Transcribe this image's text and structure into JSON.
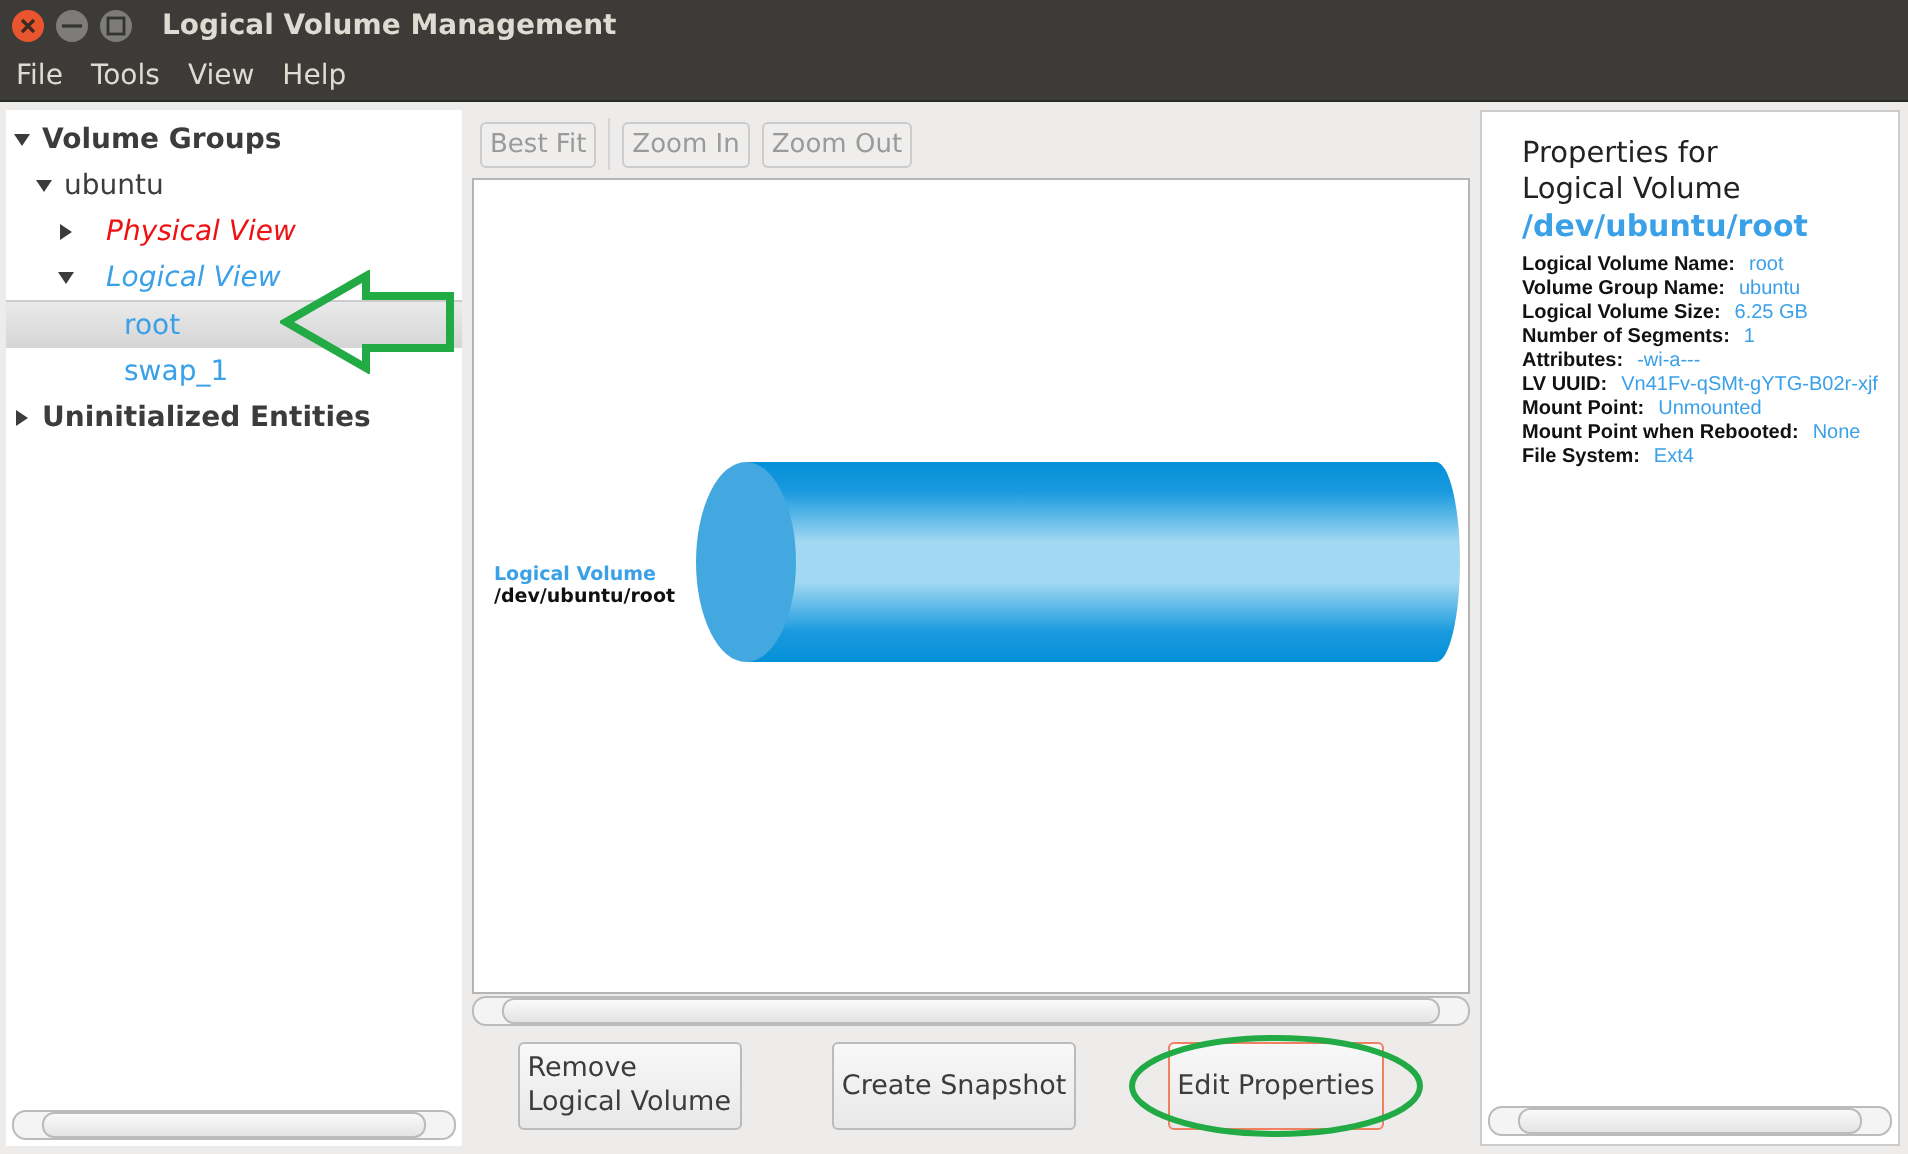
{
  "window": {
    "title": "Logical Volume Management"
  },
  "menu": [
    "File",
    "Tools",
    "View",
    "Help"
  ],
  "tree": [
    {
      "label": "Volume Groups",
      "kind": "heading",
      "expanded": true,
      "selected": false,
      "color": "#3c3c3c",
      "children": [
        {
          "label": "ubuntu",
          "kind": "group",
          "expanded": true,
          "selected": false,
          "color": "#3c3c3c",
          "children": [
            {
              "label": "Physical View",
              "kind": "view",
              "expanded": false,
              "selected": false,
              "color": "#ee1111"
            },
            {
              "label": "Logical View",
              "kind": "view",
              "expanded": true,
              "selected": false,
              "color": "#3aa0e8",
              "children": [
                {
                  "label": "root",
                  "kind": "volume",
                  "selected": true,
                  "color": "#3aa0e8"
                },
                {
                  "label": "swap_1",
                  "kind": "volume",
                  "selected": false,
                  "color": "#3aa0e8"
                }
              ]
            }
          ]
        }
      ]
    },
    {
      "label": "Uninitialized Entities",
      "kind": "heading",
      "expanded": false,
      "selected": false,
      "color": "#3c3c3c"
    }
  ],
  "toolbar": [
    {
      "label": "Best Fit",
      "disabled": true
    },
    {
      "label": "Zoom In",
      "disabled": true
    },
    {
      "label": "Zoom Out",
      "disabled": true
    }
  ],
  "canvas": {
    "kind_label": "Logical Volume",
    "path": "/dev/ubuntu/root"
  },
  "actions": [
    {
      "label": "Remove\nLogical Volume",
      "focused": false
    },
    {
      "label": "Create Snapshot",
      "focused": false
    },
    {
      "label": "Edit Properties",
      "focused": true
    }
  ],
  "properties": {
    "title": "Properties for\nLogical Volume",
    "path": "/dev/ubuntu/root",
    "fields": [
      {
        "label": "Logical Volume Name:",
        "value": "root"
      },
      {
        "label": "Volume Group Name:",
        "value": "ubuntu"
      },
      {
        "label": "Logical Volume Size:",
        "value": "6.25 GB"
      },
      {
        "label": "Number of Segments:",
        "value": "1"
      },
      {
        "label": "Attributes:",
        "value": "-wi-a---"
      },
      {
        "label": "LV UUID:",
        "value": "Vn41Fv-qSMt-gYTG-B02r-xjf"
      },
      {
        "label": "Mount Point:",
        "value": "Unmounted"
      },
      {
        "label": "Mount Point when Rebooted:",
        "value": "None"
      },
      {
        "label": "File System:",
        "value": "Ext4"
      }
    ]
  }
}
